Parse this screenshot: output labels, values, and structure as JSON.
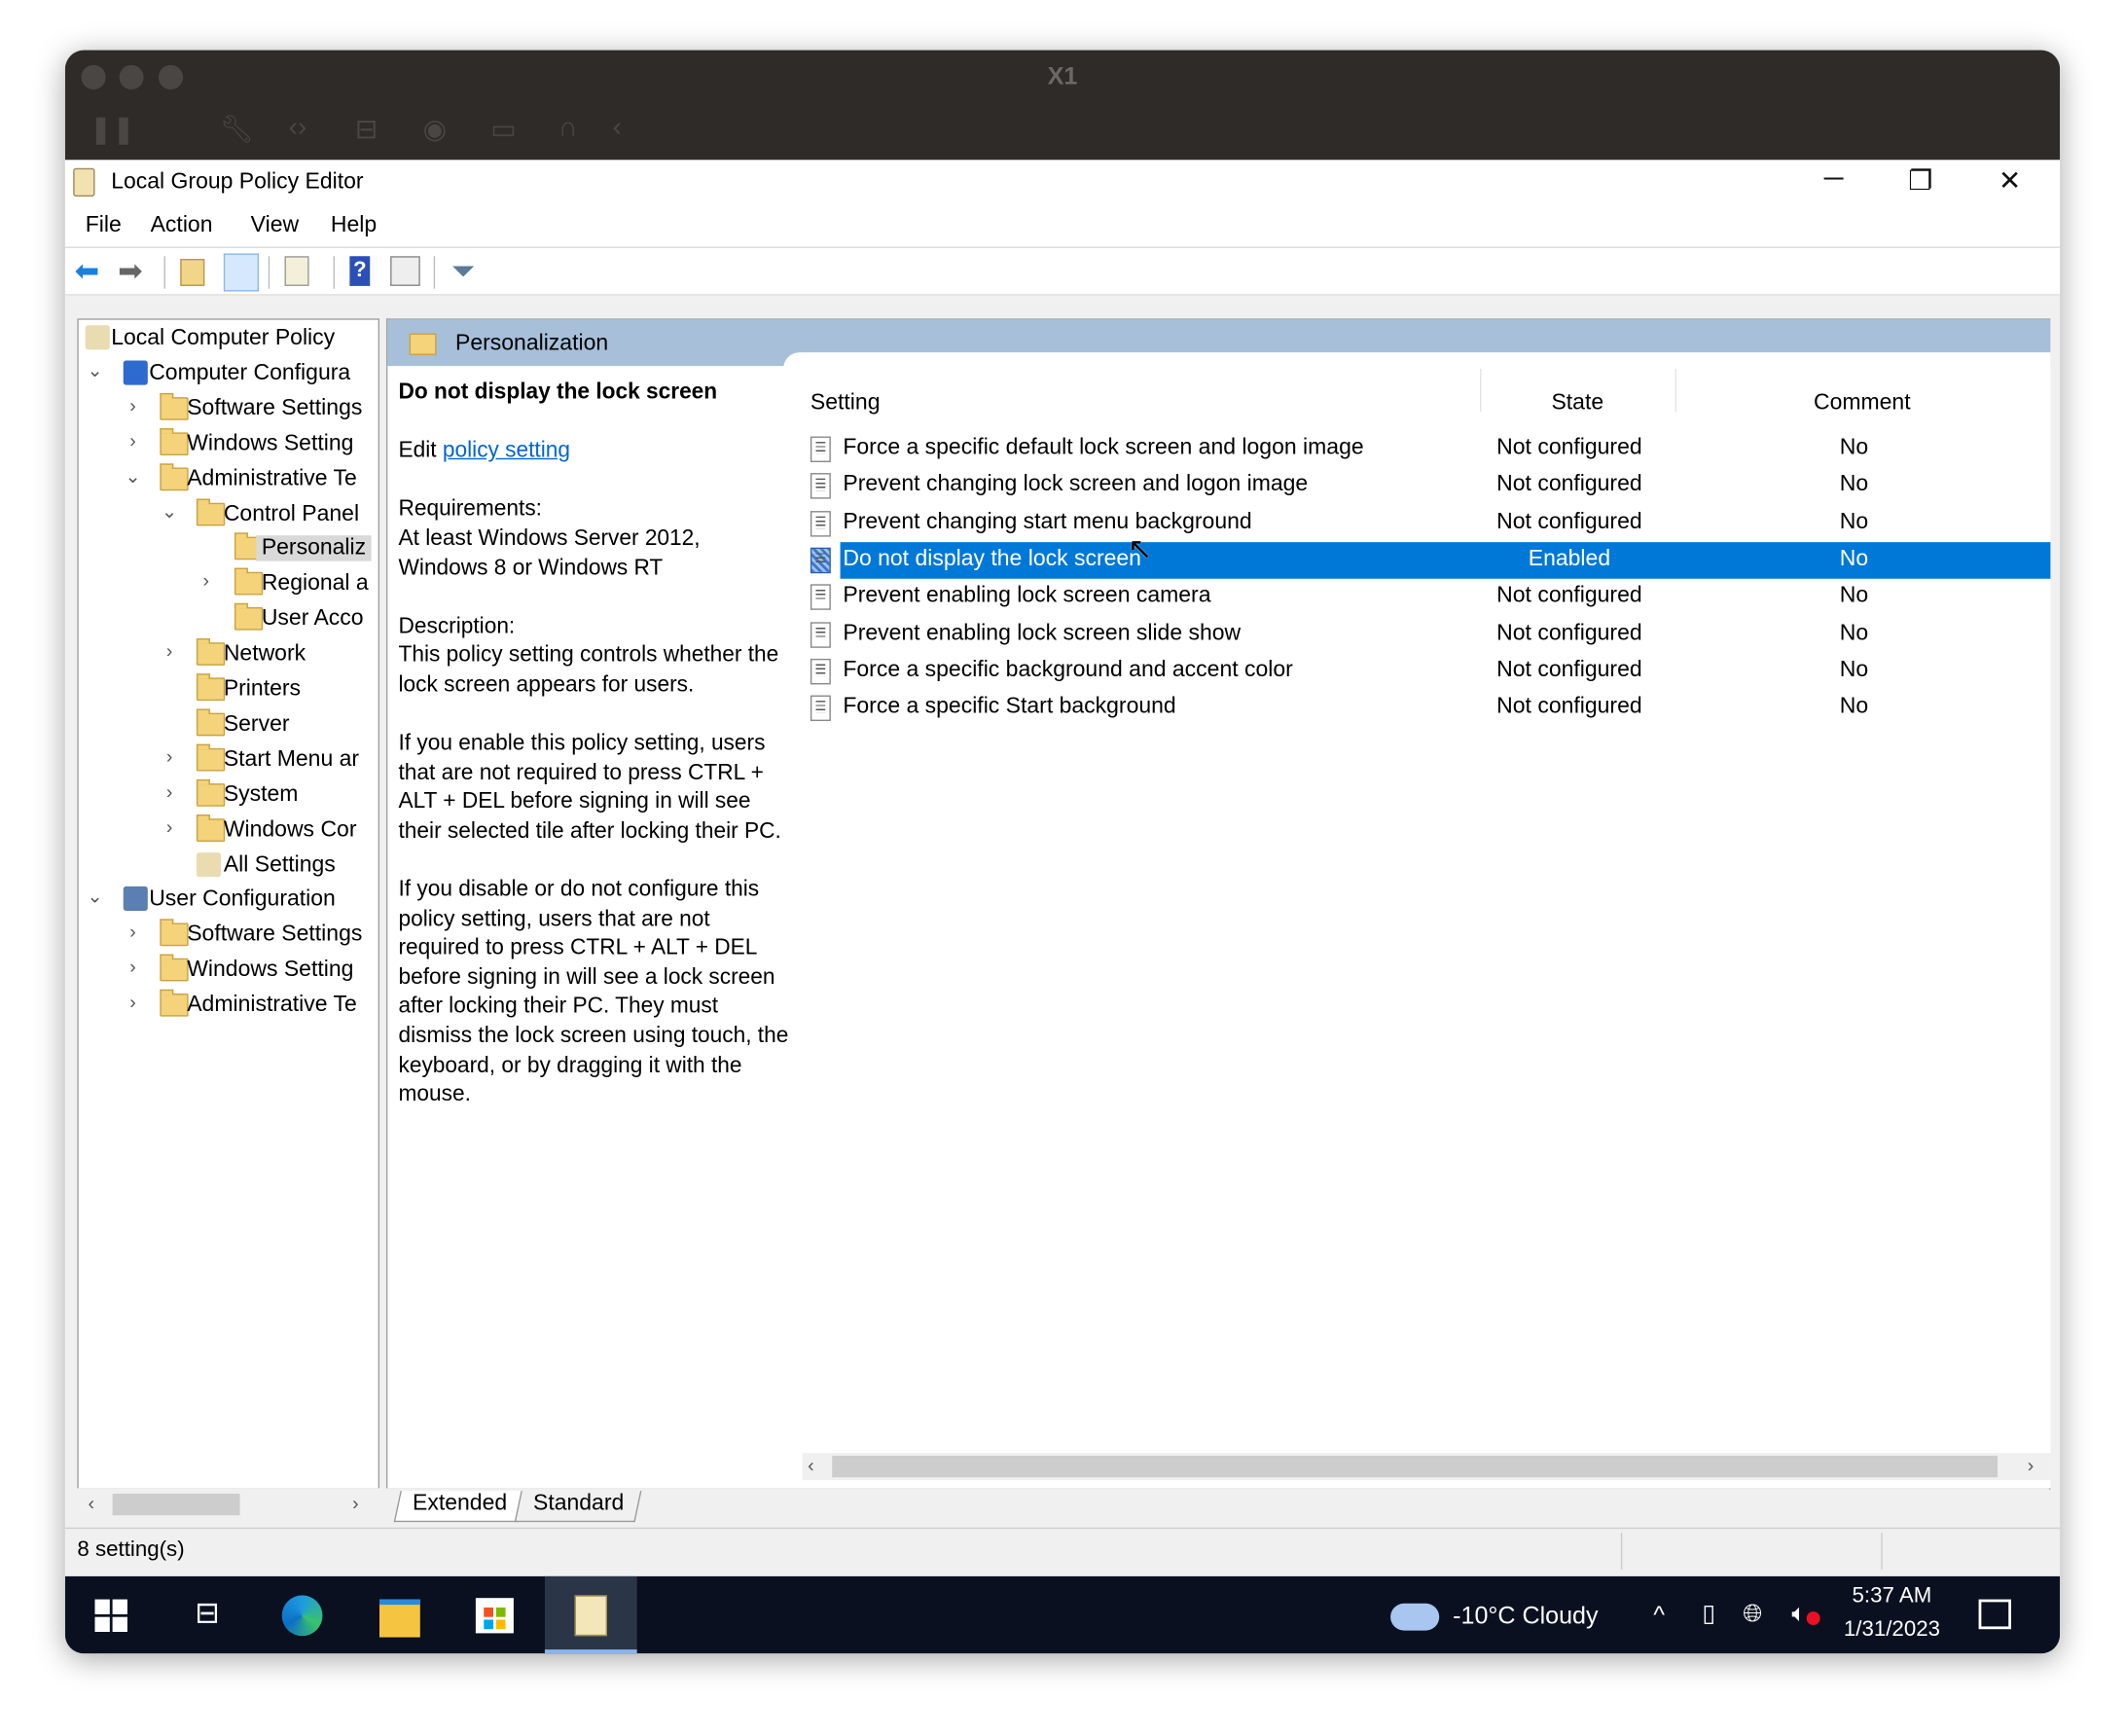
{
  "vm_window": {
    "title": "X1"
  },
  "app": {
    "title": "Local Group Policy Editor"
  },
  "menu": [
    "File",
    "Action",
    "View",
    "Help"
  ],
  "tree": [
    {
      "label": "Local Computer Policy",
      "level": 0,
      "icon": "policy-scroll-icon",
      "chevron": ""
    },
    {
      "label": "Computer Configura",
      "level": 0,
      "icon": "computer-icon",
      "chevron": "expanded"
    },
    {
      "label": "Software Settings",
      "level": 1,
      "icon": "folder-icon",
      "chevron": "collapsed"
    },
    {
      "label": "Windows Setting",
      "level": 1,
      "icon": "folder-icon",
      "chevron": "collapsed"
    },
    {
      "label": "Administrative Te",
      "level": 1,
      "icon": "folder-icon",
      "chevron": "expanded"
    },
    {
      "label": "Control Panel",
      "level": 2,
      "icon": "folder-icon",
      "chevron": "expanded"
    },
    {
      "label": "Personaliz",
      "level": 3,
      "icon": "folder-icon",
      "chevron": "",
      "selected": true
    },
    {
      "label": "Regional a",
      "level": 3,
      "icon": "folder-icon",
      "chevron": "collapsed"
    },
    {
      "label": "User Acco",
      "level": 3,
      "icon": "folder-icon",
      "chevron": ""
    },
    {
      "label": "Network",
      "level": 2,
      "icon": "folder-icon",
      "chevron": "collapsed"
    },
    {
      "label": "Printers",
      "level": 2,
      "icon": "folder-icon",
      "chevron": ""
    },
    {
      "label": "Server",
      "level": 2,
      "icon": "folder-icon",
      "chevron": ""
    },
    {
      "label": "Start Menu ar",
      "level": 2,
      "icon": "folder-icon",
      "chevron": "collapsed"
    },
    {
      "label": "System",
      "level": 2,
      "icon": "folder-icon",
      "chevron": "collapsed"
    },
    {
      "label": "Windows Cor",
      "level": 2,
      "icon": "folder-icon",
      "chevron": "collapsed"
    },
    {
      "label": "All Settings",
      "level": 2,
      "icon": "all-settings-icon",
      "chevron": ""
    },
    {
      "label": "User Configuration",
      "level": 0,
      "icon": "user-icon",
      "chevron": "expanded"
    },
    {
      "label": "Software Settings",
      "level": 1,
      "icon": "folder-icon",
      "chevron": "collapsed"
    },
    {
      "label": "Windows Setting",
      "level": 1,
      "icon": "folder-icon",
      "chevron": "collapsed"
    },
    {
      "label": "Administrative Te",
      "level": 1,
      "icon": "folder-icon",
      "chevron": "collapsed"
    }
  ],
  "header": {
    "title": "Personalization"
  },
  "description": {
    "title": "Do not display the lock screen",
    "edit_prefix": "Edit",
    "edit_link": "policy setting",
    "requirements_label": "Requirements:",
    "requirements": "At least Windows Server 2012, Windows 8 or Windows RT",
    "description_label": "Description:",
    "paragraphs": [
      "This policy setting controls whether the lock screen appears for users.",
      "If you enable this policy setting, users that are not required to press CTRL + ALT + DEL before signing in will see their selected tile after locking their PC.",
      "If you disable or do not configure this policy setting, users that are not required to press CTRL + ALT + DEL before signing in will see a lock screen after locking their PC. They must dismiss the lock screen using touch, the keyboard, or by dragging it with the mouse."
    ]
  },
  "list": {
    "columns": [
      "Setting",
      "State",
      "Comment"
    ],
    "rows": [
      {
        "setting": "Force a specific default lock screen and logon image",
        "state": "Not configured",
        "comment": "No"
      },
      {
        "setting": "Prevent changing lock screen and logon image",
        "state": "Not configured",
        "comment": "No"
      },
      {
        "setting": "Prevent changing start menu background",
        "state": "Not configured",
        "comment": "No"
      },
      {
        "setting": "Do not display the lock screen",
        "state": "Enabled",
        "comment": "No",
        "selected": true
      },
      {
        "setting": "Prevent enabling lock screen camera",
        "state": "Not configured",
        "comment": "No"
      },
      {
        "setting": "Prevent enabling lock screen slide show",
        "state": "Not configured",
        "comment": "No"
      },
      {
        "setting": "Force a specific background and accent color",
        "state": "Not configured",
        "comment": "No"
      },
      {
        "setting": "Force a specific Start background",
        "state": "Not configured",
        "comment": "No"
      }
    ]
  },
  "tabs": [
    "Extended",
    "Standard"
  ],
  "active_tab": "Extended",
  "status": {
    "text": "8 setting(s)"
  },
  "taskbar": {
    "weather": "-10°C  Cloudy",
    "time": "5:37 AM",
    "date": "1/31/2023"
  },
  "colors": {
    "selection": "#0078d7",
    "header_band": "#a7bfd9",
    "taskbar": "#0a1020",
    "link": "#0066cc"
  }
}
